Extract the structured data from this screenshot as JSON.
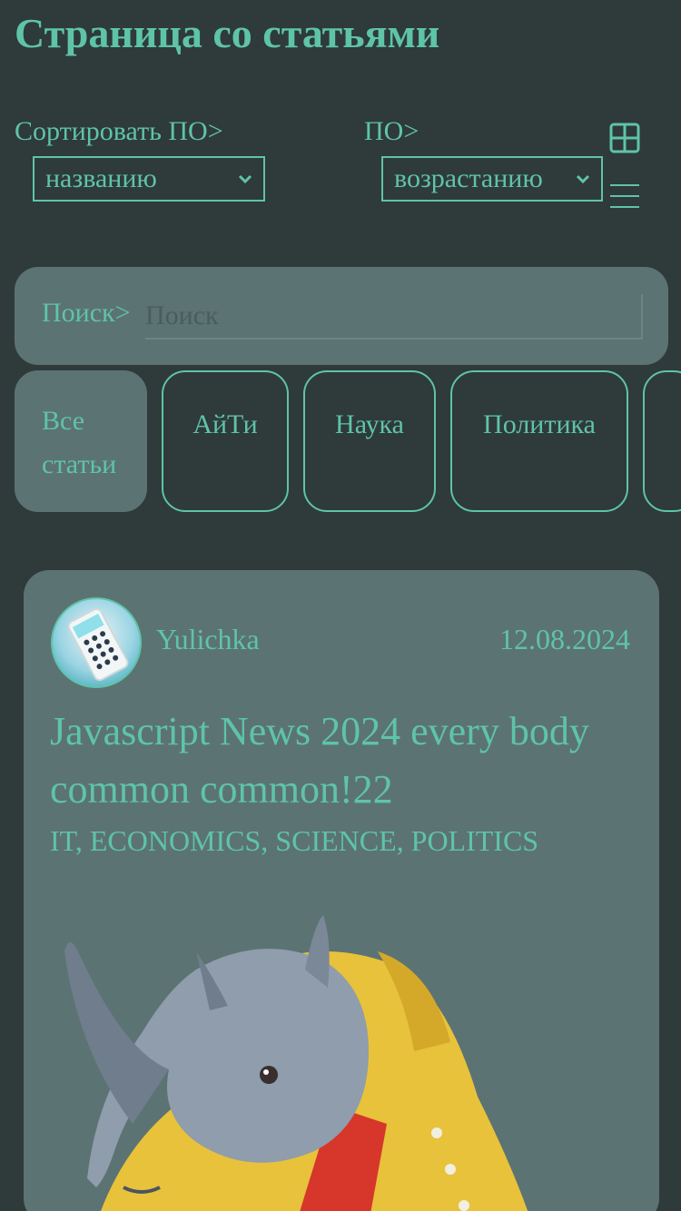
{
  "header": {
    "title": "Страница со статьями"
  },
  "sort": {
    "by_label": "Сортировать ПО>",
    "by_value": "названию",
    "order_label": "ПО>",
    "order_value": "возрастанию"
  },
  "view_icons": [
    "grid-view-icon",
    "list-view-icon"
  ],
  "search": {
    "label": "Поиск>",
    "placeholder": "Поиск"
  },
  "categories": [
    {
      "label": "Все статьи",
      "active": true
    },
    {
      "label": "АйТи",
      "active": false
    },
    {
      "label": "Наука",
      "active": false
    },
    {
      "label": "Политика",
      "active": false
    }
  ],
  "article": {
    "author": "Yulichka",
    "date": "12.08.2024",
    "title": "Javascript News 2024 every body common common!22",
    "tags": "IT, ECONOMICS, SCIENCE, POLITICS"
  },
  "colors": {
    "background": "#2f3a3a",
    "accent": "#5ec4a8",
    "panel": "#5c7373"
  }
}
